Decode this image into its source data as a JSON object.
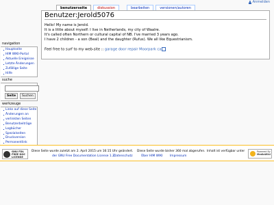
{
  "header": {
    "login_label": "Anmelden"
  },
  "tabs": [
    {
      "label": "benutzerseite"
    },
    {
      "label": "diskussion"
    },
    {
      "label": "bearbeiten"
    },
    {
      "label": "versionen/autoren"
    }
  ],
  "page": {
    "title": "Benutzer:Jerold5076",
    "paragraphs": [
      "Hello! My name is Jerold.",
      "It is a little about myself: I live in Netherlands, my city of Waalre.",
      "It's called often Northern or cultural capital of NB. I've married 3 years ago.",
      "I have 2 children - a son (Beal) and the daughter (Rufus). We all like Equestrianism."
    ],
    "link_prefix": "Feel free to surf to my web-site ::",
    "link_text": "garage door repair Moorpark ca"
  },
  "navigation": {
    "heading": "navigation",
    "items": [
      "Hauptseite",
      "HIM WIKI-Portal",
      "Aktuelle Ereignisse",
      "Letzte Änderungen",
      "Zufällige Seite",
      "Hilfe"
    ]
  },
  "search": {
    "heading": "suche",
    "go_label": "Seite",
    "search_label": "Suchen"
  },
  "toolbox": {
    "heading": "werkzeuge",
    "items": [
      "Links auf diese Seite",
      "Änderungen an",
      "verlinkten Seiten",
      "Benutzerbeiträge",
      "Logbücher",
      "Spezialseiten",
      "Druckversion",
      "Permanentlink"
    ]
  },
  "footer": {
    "gfdl_badge": [
      "GNU FDL",
      "FREE DOC",
      "LICENSE"
    ],
    "last_modified": "Diese Seite wurde zuletzt am 2. April 2015 um 16:15 Uhr geändert.",
    "views": "Diese Seite wurde bisher 360 mal abgerufen.",
    "license_text": "Inhalt ist verfügbar unter",
    "license_link": "der GNU Free Documentation License 1.2.",
    "privacy": "Datenschutz",
    "about": "Über HIM WIKI",
    "imprint": "Impressum",
    "mw_badge": [
      "Powered By",
      "MediaWiki"
    ]
  }
}
